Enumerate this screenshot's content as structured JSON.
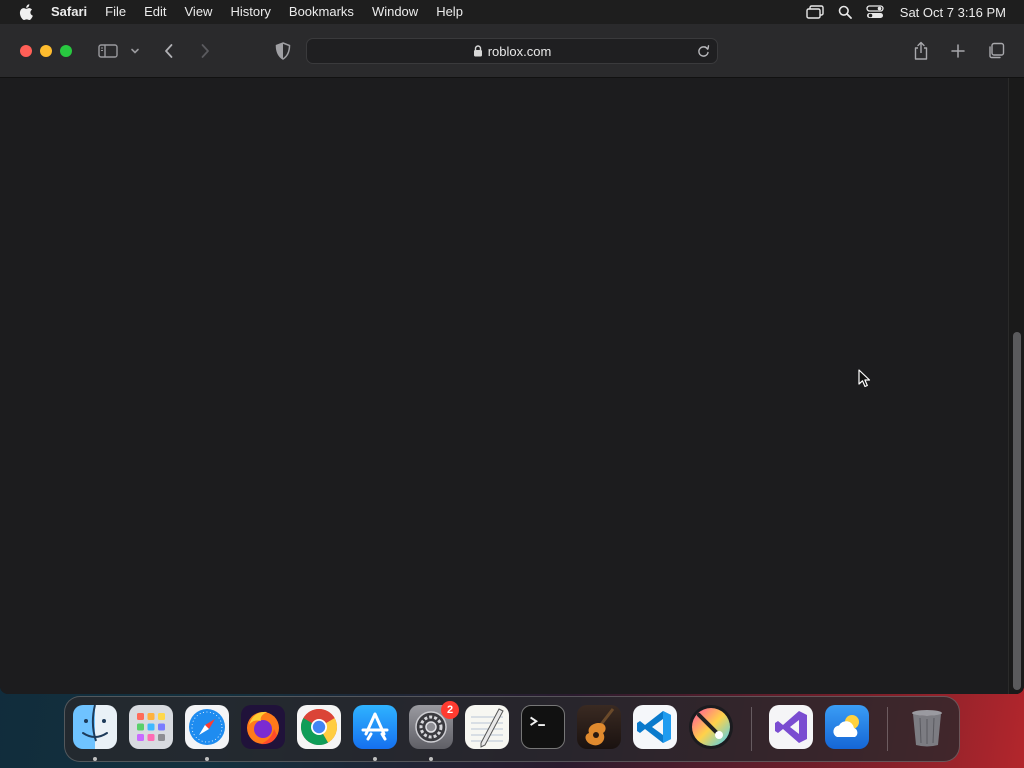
{
  "menubar": {
    "apple_icon": "apple-logo-icon",
    "items": [
      {
        "label": "Safari"
      },
      {
        "label": "File"
      },
      {
        "label": "Edit"
      },
      {
        "label": "View"
      },
      {
        "label": "History"
      },
      {
        "label": "Bookmarks"
      },
      {
        "label": "Window"
      },
      {
        "label": "Help"
      }
    ],
    "status_icons": [
      "screen-mirroring-icon",
      "spotlight-search-icon",
      "control-center-icon"
    ],
    "clock": "Sat Oct 7  3:16 PM"
  },
  "window": {
    "address": {
      "url": "roblox.com",
      "secure": true
    }
  },
  "dock": {
    "apps": [
      {
        "name": "Finder",
        "running": true
      },
      {
        "name": "Launchpad",
        "running": false
      },
      {
        "name": "Safari",
        "running": true
      },
      {
        "name": "Firefox",
        "running": false
      },
      {
        "name": "Google Chrome",
        "running": false
      },
      {
        "name": "App Store",
        "running": true
      },
      {
        "name": "System Settings",
        "running": true,
        "badge": "2"
      },
      {
        "name": "TextEdit",
        "running": false
      },
      {
        "name": "Terminal",
        "running": false
      },
      {
        "name": "GarageBand",
        "running": false
      },
      {
        "name": "Visual Studio Code",
        "running": false
      },
      {
        "name": "Pixelmator",
        "running": false
      },
      {
        "name": "Visual Studio",
        "running": false
      },
      {
        "name": "Weather",
        "running": false
      },
      {
        "name": "Trash",
        "running": false
      }
    ]
  },
  "colors": {
    "close": "#ff5f57",
    "minimize": "#febc2e",
    "maximize": "#28c840",
    "badge": "#ff3b30"
  }
}
